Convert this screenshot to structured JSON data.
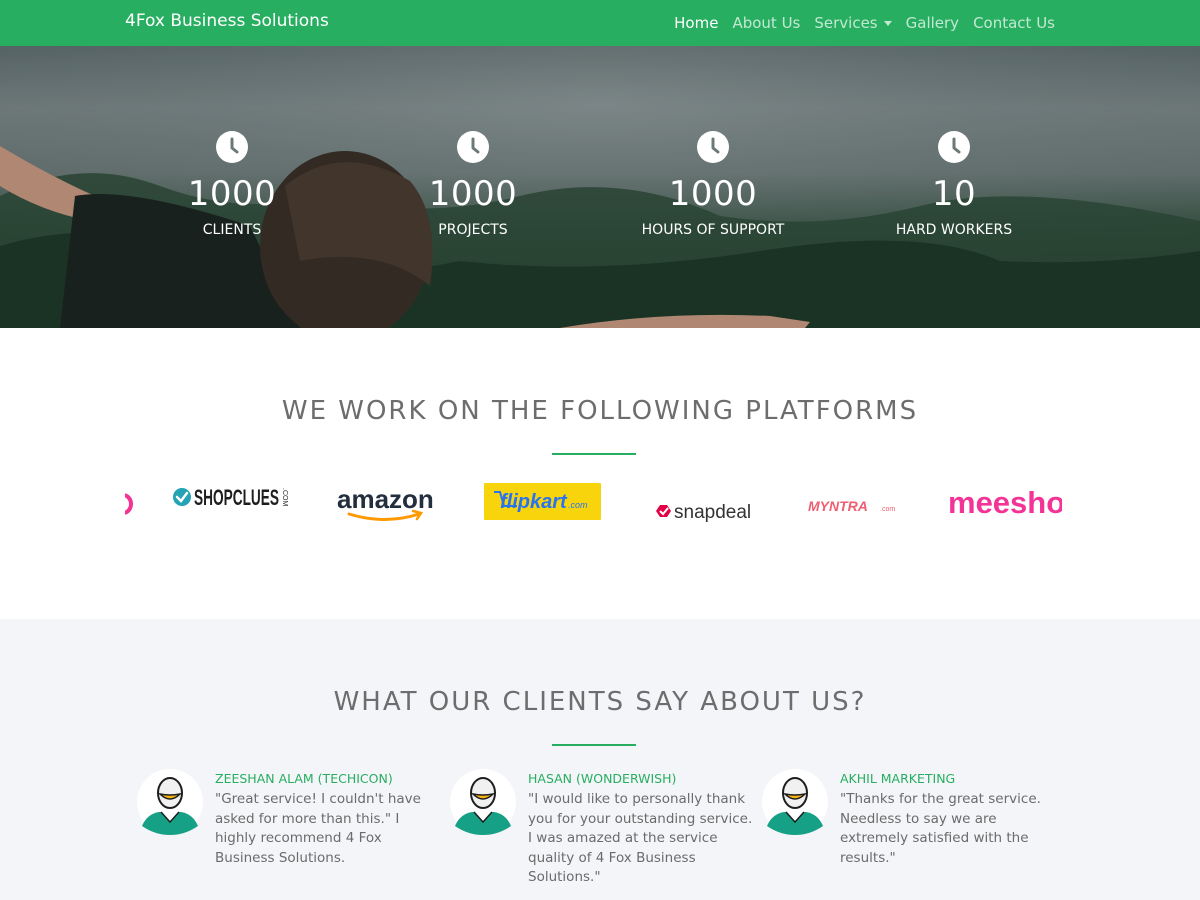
{
  "navbar": {
    "brand": "4Fox Business Solutions",
    "links": [
      {
        "label": "Home",
        "active": true
      },
      {
        "label": "About Us"
      },
      {
        "label": "Services",
        "dropdown": true
      },
      {
        "label": "Gallery"
      },
      {
        "label": "Contact Us"
      }
    ],
    "accent_color": "#27ae60"
  },
  "stats": [
    {
      "icon": "clock-icon",
      "number": "1000",
      "label": "CLIENTS"
    },
    {
      "icon": "clock-icon",
      "number": "1000",
      "label": "PROJECTS"
    },
    {
      "icon": "clock-icon",
      "number": "1000",
      "label": "HOURS OF SUPPORT"
    },
    {
      "icon": "clock-icon",
      "number": "10",
      "label": "HARD WORKERS"
    }
  ],
  "platforms": {
    "title": "WE WORK ON THE FOLLOWING PLATFORMS",
    "logos": [
      {
        "name": "shopclues",
        "text": "SHOPCLUES",
        "suffix": ".COM"
      },
      {
        "name": "amazon",
        "text": "amazon"
      },
      {
        "name": "flipkart",
        "text": "flipkart",
        "suffix": ".com"
      },
      {
        "name": "snapdeal",
        "text": "snapdeal"
      },
      {
        "name": "myntra",
        "text": "MYNTRA",
        "suffix": ".com"
      },
      {
        "name": "meesho",
        "text": "meesho"
      }
    ]
  },
  "testimonials": {
    "title": "WHAT OUR CLIENTS SAY ABOUT US?",
    "items": [
      {
        "name": "ZEESHAN ALAM (TECHICON)",
        "quote": "\"Great service! I couldn't have asked for more than this.\" I highly recommend 4 Fox Business Solutions."
      },
      {
        "name": "HASAN (WONDERWISH)",
        "quote": "\"I would like to personally thank you for your outstanding service. I was amazed at the service quality of 4 Fox Business Solutions.\""
      },
      {
        "name": "AKHIL MARKETING",
        "quote": "\"Thanks for the great service. Needless to say we are extremely satisfied with the results.\""
      }
    ]
  }
}
